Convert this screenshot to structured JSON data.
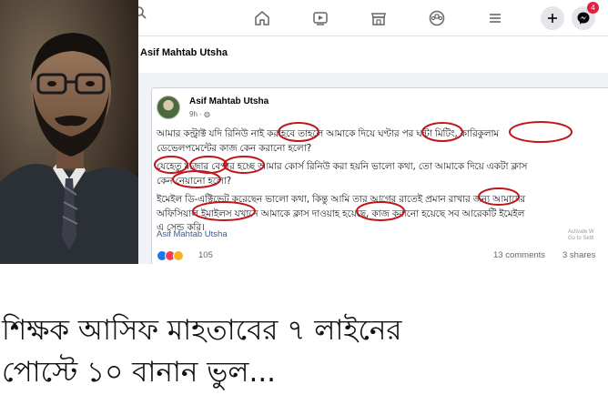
{
  "facebook": {
    "profile_name": "Asif Mahtab Utsha",
    "notification_count": "4",
    "post": {
      "author": "Asif Mahtab Utsha",
      "time": "9h · ",
      "lines": [
        "আমার কন্ট্রাক্ট যদি রিনিউ নাই করাহবে তাহলে আমাকে দিয়ে ঘণ্টার পর ঘন্টা মিটিং, কারিকুলাম",
        "ডেভেলপমেন্টের কাজ কেন করানো হলো?",
        "যেহেতু মাজার বেপার হচ্ছে আমার কোর্স রিনিউ করা হয়নি ভালো কথা, তো আমাকে দিয়ে একটা ক্লাস",
        "কেন নেয়ানো হলো?",
        "ইমেইল ডি-এক্টিভেট করেছেন ভালো কথা, কিন্তু আমি তার আগের রাতেই প্রমান রাখার জন্য আমাদের",
        "অফিসিয়াল ইমাইলস যখানে আমাকে ক্লাস দাওয়াহ হয়েছে, কাজ করানো হয়েছে সব আরেকটি ইমেইল",
        "এ সেন্ড করি।"
      ],
      "footer_name": "Asif Mahtab Utsha",
      "activate_note_1": "Activate W",
      "activate_note_2": "Go to Setti",
      "reaction_count": "105",
      "comments": "13 comments",
      "shares": "3 shares"
    }
  },
  "caption": {
    "line1": "শিক্ষক আসিফ মাহতাবের ৭ লাইনের",
    "line2": "পোস্টে ১০ বানান ভুল..."
  },
  "colors": {
    "facebook_blue": "#1877f2",
    "error_circle": "#c0151c",
    "notification_red": "#e41e3f"
  },
  "icons": [
    "search-icon",
    "home-icon",
    "watch-icon",
    "marketplace-icon",
    "groups-icon",
    "menu-icon",
    "plus-icon",
    "messenger-icon",
    "globe-icon"
  ]
}
